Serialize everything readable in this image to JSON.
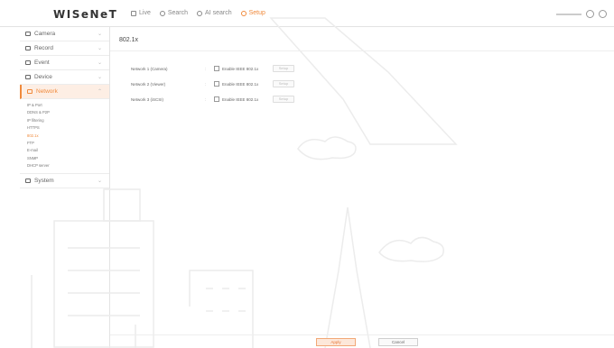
{
  "app": {
    "logo": "WISeNeT"
  },
  "nav": {
    "items": [
      {
        "label": "Live",
        "icon": "monitor-icon",
        "active": false
      },
      {
        "label": "Search",
        "icon": "search-icon",
        "active": false
      },
      {
        "label": "AI search",
        "icon": "ai-search-icon",
        "active": false
      },
      {
        "label": "Setup",
        "icon": "gear-icon",
        "active": true
      }
    ]
  },
  "sidebar": {
    "menus": [
      {
        "label": "Camera",
        "icon": "camera-icon"
      },
      {
        "label": "Record",
        "icon": "record-icon"
      },
      {
        "label": "Event",
        "icon": "event-icon"
      },
      {
        "label": "Device",
        "icon": "device-icon"
      },
      {
        "label": "Network",
        "icon": "network-icon",
        "active": true
      }
    ],
    "network_sub": [
      "IP & Port",
      "DDNS & P2P",
      "IP filtering",
      "HTTPS",
      "802.1x",
      "FTP",
      "E-mail",
      "SNMP",
      "DHCP server"
    ],
    "system": {
      "label": "System",
      "icon": "system-icon"
    }
  },
  "page": {
    "title": "802.1x",
    "networks": [
      {
        "label": "Network 1 (Camera)",
        "checkbox": "Enable IEEE 802.1x",
        "button": "Setup"
      },
      {
        "label": "Network 2 (Viewer)",
        "checkbox": "Enable IEEE 802.1x",
        "button": "Setup"
      },
      {
        "label": "Network 3 (iSCSI)",
        "checkbox": "Enable IEEE 802.1x",
        "button": "Setup"
      }
    ]
  },
  "footer": {
    "apply": "Apply",
    "cancel": "Cancel"
  },
  "colors": {
    "accent": "#f08a3c",
    "active_bg": "#fdeee4"
  }
}
